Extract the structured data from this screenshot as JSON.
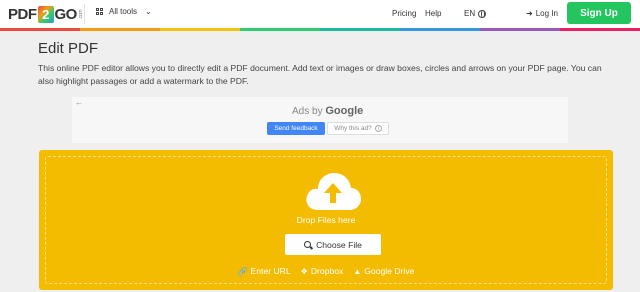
{
  "header": {
    "logo": {
      "pdf": "PDF",
      "two": "2",
      "go": "GO",
      "dotcom": ".com"
    },
    "all_tools_label": "All tools",
    "nav": {
      "pricing": "Pricing",
      "help": "Help",
      "language": "EN"
    },
    "login_label": "Log In",
    "signup_label": "Sign Up",
    "rainbow_colors": [
      "#e74c3c",
      "#f39c12",
      "#f1c40f",
      "#2ecc71",
      "#1abc9c",
      "#3498db",
      "#9b59b6",
      "#e91e63"
    ]
  },
  "main": {
    "title": "Edit PDF",
    "description": "This online PDF editor allows you to directly edit a PDF document. Add text or images or draw boxes, circles and arrows on your PDF page. You can also highlight passages or add a watermark to the PDF."
  },
  "ad": {
    "ads_by": "Ads by",
    "google": "Google",
    "send_feedback": "Send feedback",
    "why_this_ad": "Why this ad?"
  },
  "upload": {
    "drop_text": "Drop Files here",
    "choose_file": "Choose File",
    "enter_url": "Enter URL",
    "dropbox": "Dropbox",
    "google_drive": "Google Drive",
    "accent_color": "#f4bc00"
  },
  "colors": {
    "signup": "#22c55e",
    "feedback_button": "#4285f4"
  }
}
